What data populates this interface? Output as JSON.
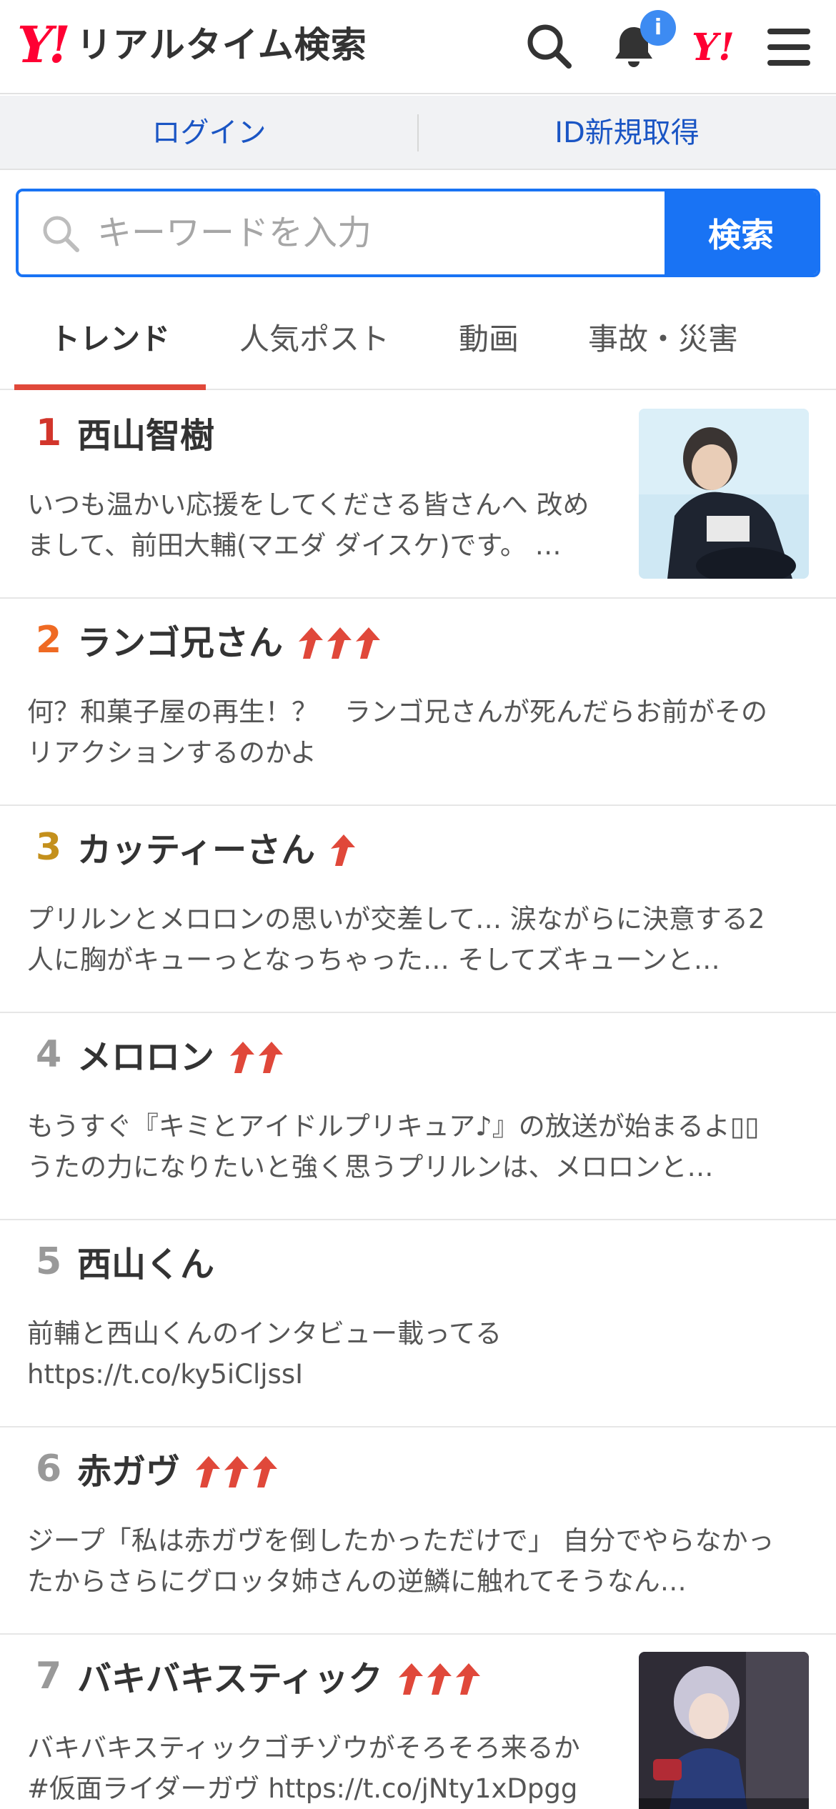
{
  "header": {
    "logo_y": "Y!",
    "logo_text": "リアルタイム検索",
    "notification_count": "i",
    "icons": [
      "search-icon",
      "bell-icon",
      "yahoo-icon",
      "menu-icon"
    ]
  },
  "account": {
    "login": "ログイン",
    "register": "ID新規取得"
  },
  "search": {
    "placeholder": "キーワードを入力",
    "button": "検索"
  },
  "tabs": [
    {
      "label": "トレンド",
      "active": true
    },
    {
      "label": "人気ポスト",
      "active": false
    },
    {
      "label": "動画",
      "active": false
    },
    {
      "label": "事故・災害",
      "active": false
    }
  ],
  "colors": {
    "accent": "#1973f4",
    "brand": "#ff0033",
    "tab_underline": "#e0483a",
    "rank1": "#d2352b",
    "rank2": "#ef6a23",
    "rank3": "#c4901c",
    "rank_other": "#999999",
    "arrow": "#e0483a"
  },
  "trends": [
    {
      "rank": "1",
      "title": "西山智樹",
      "arrows": 0,
      "desc": "いつも温かい応援をしてくださる皆さんへ 改めまして、前田大輔(マエダ ダイスケ)です。 …",
      "thumbnail": true
    },
    {
      "rank": "2",
      "title": "ランゴ兄さん",
      "arrows": 3,
      "desc": "何？和菓子屋の再生！？　ランゴ兄さんが死んだらお前がそのリアクションするのかよ",
      "thumbnail": false
    },
    {
      "rank": "3",
      "title": "カッティーさん",
      "arrows": 1,
      "desc": "プリルンとメロロンの思いが交差して… 涙ながらに決意する2人に胸がキューっとなっちゃった… そしてズキューンと…",
      "thumbnail": false
    },
    {
      "rank": "4",
      "title": "メロロン",
      "arrows": 2,
      "desc": "もうすぐ『キミとアイドルプリキュア♪』の放送が始まるよ▯▯ うたの力になりたいと強く思うプリルンは、メロロンと…",
      "thumbnail": false
    },
    {
      "rank": "5",
      "title": "西山くん",
      "arrows": 0,
      "desc": "前輔と西山くんのインタビュー載ってる https://t.co/ky5iCljssI",
      "thumbnail": false
    },
    {
      "rank": "6",
      "title": "赤ガヴ",
      "arrows": 3,
      "desc": "ジープ「私は赤ガヴを倒したかっただけで」 自分でやらなかったからさらにグロッタ姉さんの逆鱗に触れてそうなん…",
      "thumbnail": false
    },
    {
      "rank": "7",
      "title": "バキバキスティック",
      "arrows": 3,
      "desc": "バキバキスティックゴチゾウがそろそろ来るか #仮面ライダーガヴ https://t.co/jNty1xDpgg",
      "thumbnail": true
    }
  ]
}
